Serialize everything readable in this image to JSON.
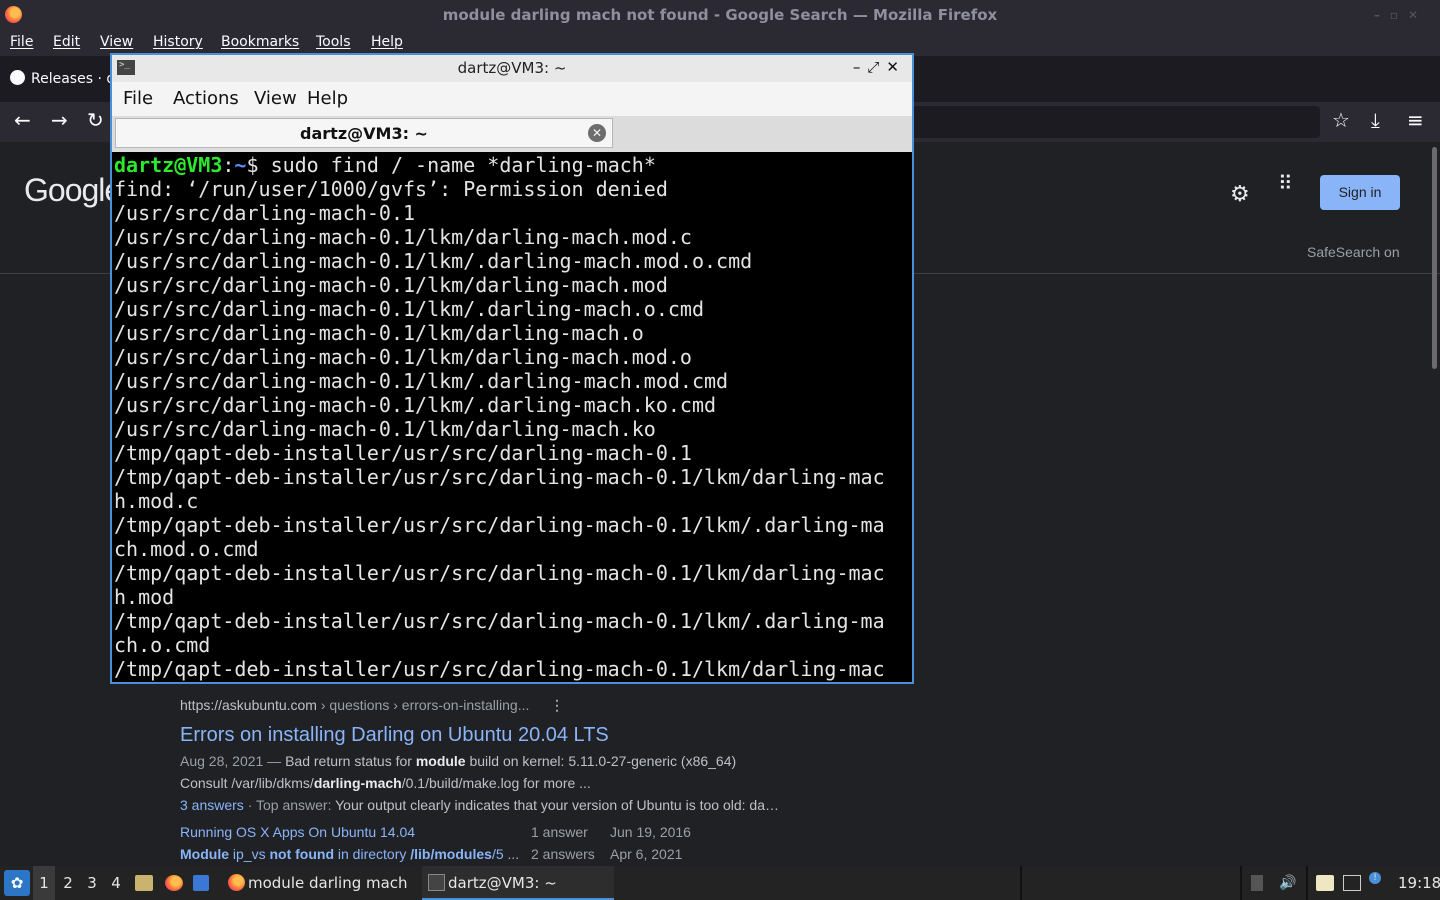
{
  "firefox": {
    "window_title": "module darling mach not found - Google Search — Mozilla Firefox",
    "menu": [
      "File",
      "Edit",
      "View",
      "History",
      "Bookmarks",
      "Tools",
      "Help"
    ],
    "tab_label": "Releases · d"
  },
  "google": {
    "logo": "Google",
    "sign_in": "Sign in",
    "safesearch": "SafeSearch on",
    "result": {
      "cite_domain": "https://askubuntu.com",
      "cite_path": " › questions › errors-on-installing...",
      "title": "Errors on installing Darling on Ubuntu 20.04 LTS",
      "snippet1_date": "Aug 28, 2021 — ",
      "snippet1_a": "Bad return status for ",
      "snippet1_b": "module",
      "snippet1_c": " build on kernel: 5.11.0-27-generic (x86_64)",
      "snippet2_a": "Consult /var/lib/dkms/",
      "snippet2_b": "darling-mach",
      "snippet2_c": "/0.1/build/make.log for more ...",
      "answers_link": "3 answers",
      "snippet3_a": " · Top answer: ",
      "snippet3_b": "Your output clearly indicates that your version of Ubuntu is too old: da…",
      "sub1": {
        "title": "Running OS X Apps On Ubuntu 14.04",
        "answers": "1 answer",
        "date": "Jun 19, 2016"
      },
      "sub2": {
        "title_a": "Module",
        "title_b": " ip_vs ",
        "title_c": "not found",
        "title_d": " in directory ",
        "title_e": "/lib/modules",
        "title_f": "/5 ...",
        "answers": "2 answers",
        "date": "Apr 6, 2021"
      }
    }
  },
  "terminal": {
    "window_title": "dartz@VM3: ~",
    "menu": [
      "File",
      "Actions",
      "View",
      "Help"
    ],
    "tab_label": "dartz@VM3: ~",
    "prompt_user": "dartz@VM3",
    "prompt_sep": ":",
    "prompt_path": "~",
    "prompt_end": "$ ",
    "command": "sudo find / -name *darling-mach*",
    "output": [
      "find: ‘/run/user/1000/gvfs’: Permission denied",
      "/usr/src/darling-mach-0.1",
      "/usr/src/darling-mach-0.1/lkm/darling-mach.mod.c",
      "/usr/src/darling-mach-0.1/lkm/.darling-mach.mod.o.cmd",
      "/usr/src/darling-mach-0.1/lkm/darling-mach.mod",
      "/usr/src/darling-mach-0.1/lkm/.darling-mach.o.cmd",
      "/usr/src/darling-mach-0.1/lkm/darling-mach.o",
      "/usr/src/darling-mach-0.1/lkm/darling-mach.mod.o",
      "/usr/src/darling-mach-0.1/lkm/.darling-mach.mod.cmd",
      "/usr/src/darling-mach-0.1/lkm/.darling-mach.ko.cmd",
      "/usr/src/darling-mach-0.1/lkm/darling-mach.ko",
      "/tmp/qapt-deb-installer/usr/src/darling-mach-0.1",
      "/tmp/qapt-deb-installer/usr/src/darling-mach-0.1/lkm/darling-mac",
      "h.mod.c",
      "/tmp/qapt-deb-installer/usr/src/darling-mach-0.1/lkm/.darling-ma",
      "ch.mod.o.cmd",
      "/tmp/qapt-deb-installer/usr/src/darling-mach-0.1/lkm/darling-mac",
      "h.mod",
      "/tmp/qapt-deb-installer/usr/src/darling-mach-0.1/lkm/.darling-ma",
      "ch.o.cmd",
      "/tmp/qapt-deb-installer/usr/src/darling-mach-0.1/lkm/darling-mac"
    ]
  },
  "taskbar": {
    "workspaces": [
      "1",
      "2",
      "3",
      "4"
    ],
    "tasks": [
      {
        "label": "module darling mach ..."
      },
      {
        "label": "dartz@VM3: ~"
      }
    ],
    "clock": "19:18"
  }
}
